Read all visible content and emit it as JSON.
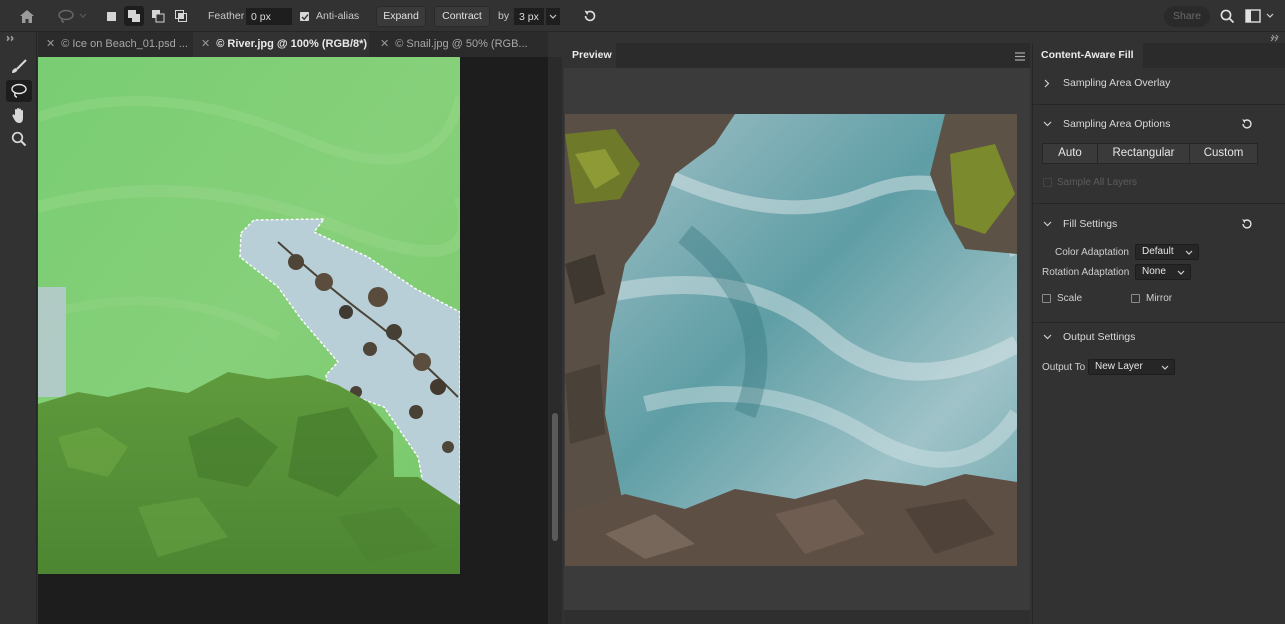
{
  "options_bar": {
    "feather_label": "Feather",
    "feather_value": "0 px",
    "antialias_label": "Anti-alias",
    "antialias_checked": true,
    "expand_label": "Expand",
    "contract_label": "Contract",
    "by_label": "by",
    "by_value": "3 px",
    "share_label": "Share"
  },
  "tabs": [
    {
      "close": "✕",
      "title": "© Ice on Beach_01.psd ...",
      "active": false
    },
    {
      "close": "✕",
      "title": "© River.jpg @ 100% (RGB/8*)",
      "active": true
    },
    {
      "close": "✕",
      "title": "© Snail.jpg @ 50% (RGB...",
      "active": false
    }
  ],
  "tools": [
    {
      "name": "brush-tool-icon"
    },
    {
      "name": "lasso-tool-icon",
      "active": true
    },
    {
      "name": "hand-tool-icon"
    },
    {
      "name": "zoom-tool-icon"
    }
  ],
  "preview": {
    "tab_label": "Preview"
  },
  "caf": {
    "tab_label": "Content-Aware Fill",
    "sampling_overlay": {
      "title": "Sampling Area Overlay",
      "expanded": false
    },
    "sampling_options": {
      "title": "Sampling Area Options",
      "modes": [
        "Auto",
        "Rectangular",
        "Custom"
      ],
      "sample_all_layers": "Sample All Layers"
    },
    "fill_settings": {
      "title": "Fill Settings",
      "color_adaptation_label": "Color Adaptation",
      "color_adaptation_value": "Default",
      "rotation_adaptation_label": "Rotation Adaptation",
      "rotation_adaptation_value": "None",
      "scale_label": "Scale",
      "mirror_label": "Mirror"
    },
    "output_settings": {
      "title": "Output Settings",
      "output_to_label": "Output To",
      "output_to_value": "New Layer"
    }
  },
  "colors": {
    "accent": "#4a90e2",
    "panel_bg": "#323232",
    "sampling_overlay_green": "#7dcf6b"
  }
}
